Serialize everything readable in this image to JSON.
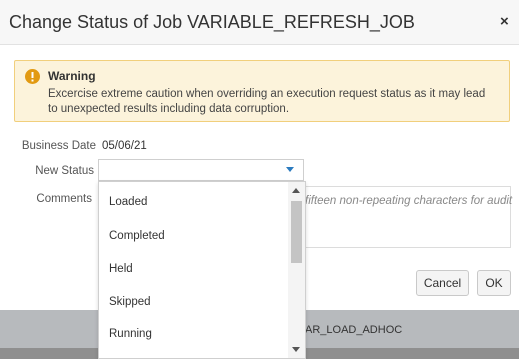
{
  "dialog": {
    "title": "Change Status of Job VARIABLE_REFRESH_JOB",
    "close_label": "×"
  },
  "warning": {
    "heading": "Warning",
    "text": "Excercise extreme caution when overriding an execution request status as it may lead to unexpected results including data corruption."
  },
  "form": {
    "business_date_label": "Business Date",
    "business_date_value": "05/06/21",
    "new_status_label": "New Status",
    "new_status_value": "",
    "comments_label": "Comments",
    "comments_placeholder": "fifteen non-repeating characters for audit"
  },
  "dropdown": {
    "options": [
      "Loaded",
      "Completed",
      "Held",
      "Skipped",
      "Running"
    ]
  },
  "buttons": {
    "cancel": "Cancel",
    "ok": "OK"
  },
  "background": {
    "row_text": "AR_LOAD_ADHOC"
  },
  "colors": {
    "warning_bg": "#fcf3db",
    "warning_border": "#f1cf7c",
    "warning_icon": "#e29a12",
    "select_arrow": "#2b7bbf"
  }
}
